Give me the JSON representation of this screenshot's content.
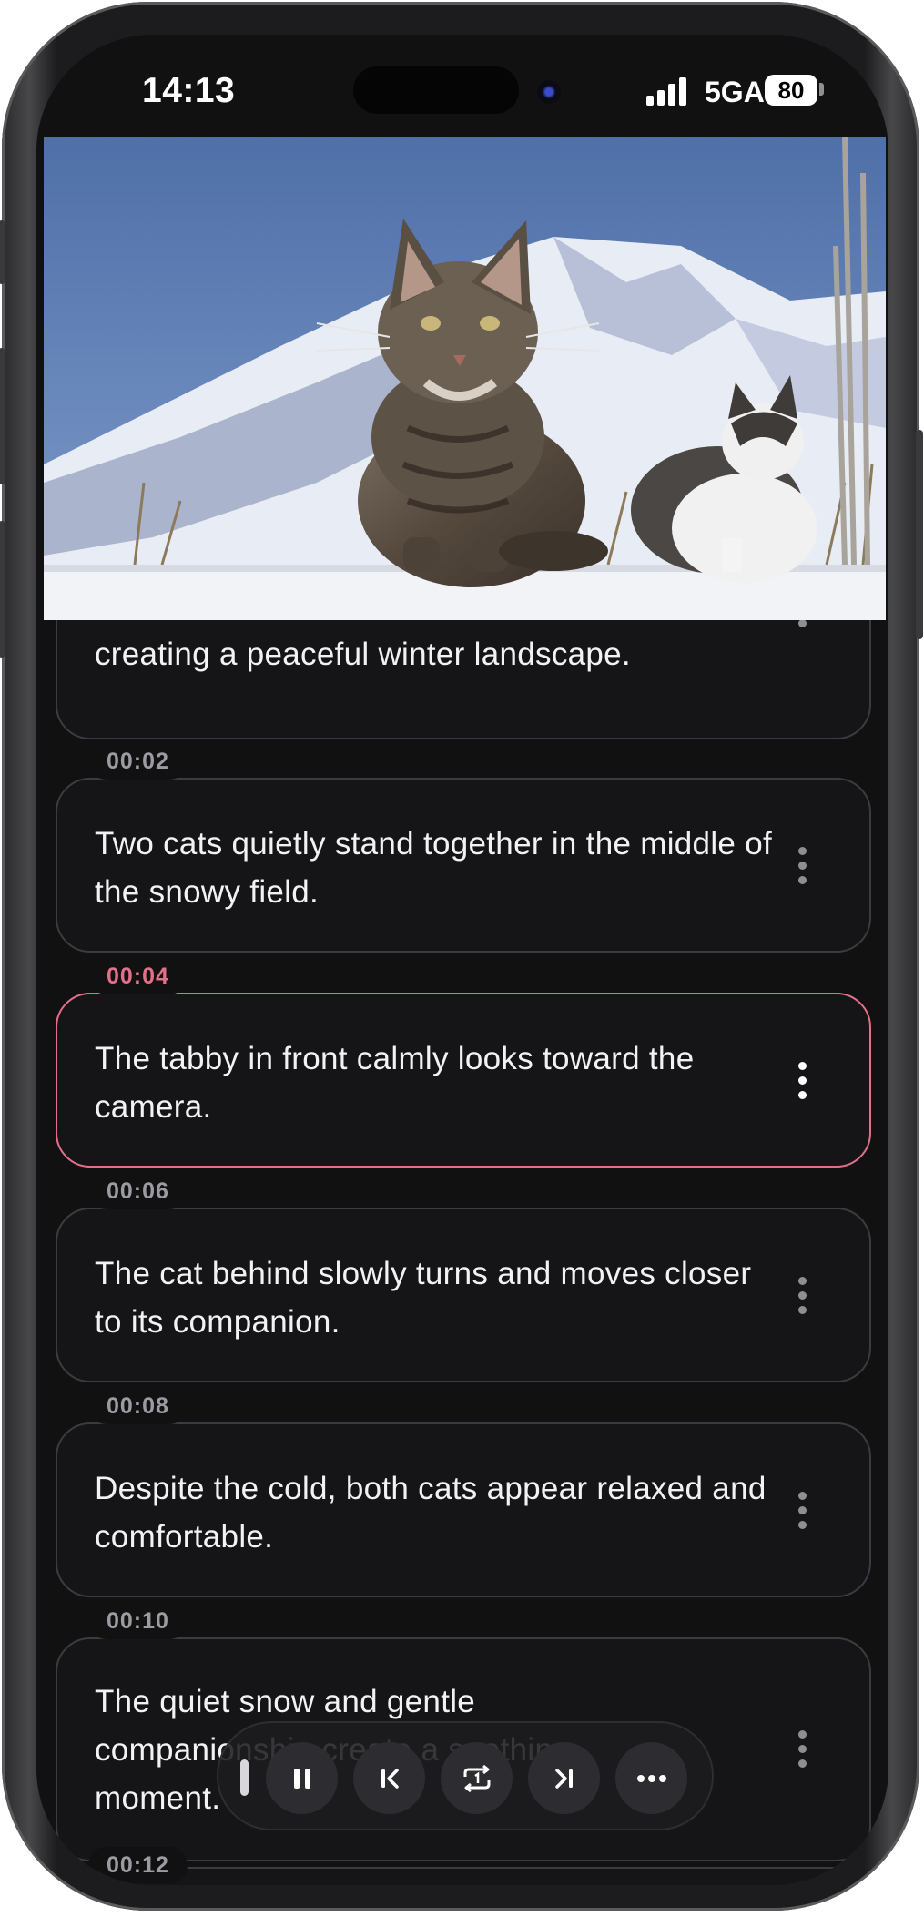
{
  "status_bar": {
    "time": "14:13",
    "network": "5GA",
    "battery_level": "80",
    "signal_bars": 4
  },
  "video": {
    "description_icon": "video-frame"
  },
  "subtitles": [
    {
      "timestamp": "",
      "text": "creating a peaceful winter landscape.",
      "active": false
    },
    {
      "timestamp": "00:02",
      "text": "Two cats quietly stand together in the middle of the snowy field.",
      "active": false
    },
    {
      "timestamp": "00:04",
      "text": "The tabby in front calmly looks toward the camera.",
      "active": true
    },
    {
      "timestamp": "00:06",
      "text": "The cat behind slowly turns and moves closer to its companion.",
      "active": false
    },
    {
      "timestamp": "00:08",
      "text": "Despite the cold, both cats appear relaxed and comfortable.",
      "active": false
    },
    {
      "timestamp": "00:10",
      "text": "The quiet snow and gentle companionship create a soothing moment.",
      "active": false
    },
    {
      "timestamp": "00:12",
      "text": "",
      "active": false
    }
  ],
  "player_controls": {
    "buttons": [
      "pause-icon",
      "previous-icon",
      "repeat-one-icon",
      "next-icon",
      "more-icon"
    ]
  },
  "colors": {
    "accent": "#e2708a",
    "background": "#111112",
    "card_border": "#3c3c40",
    "timestamp": "#9b9ba1"
  }
}
